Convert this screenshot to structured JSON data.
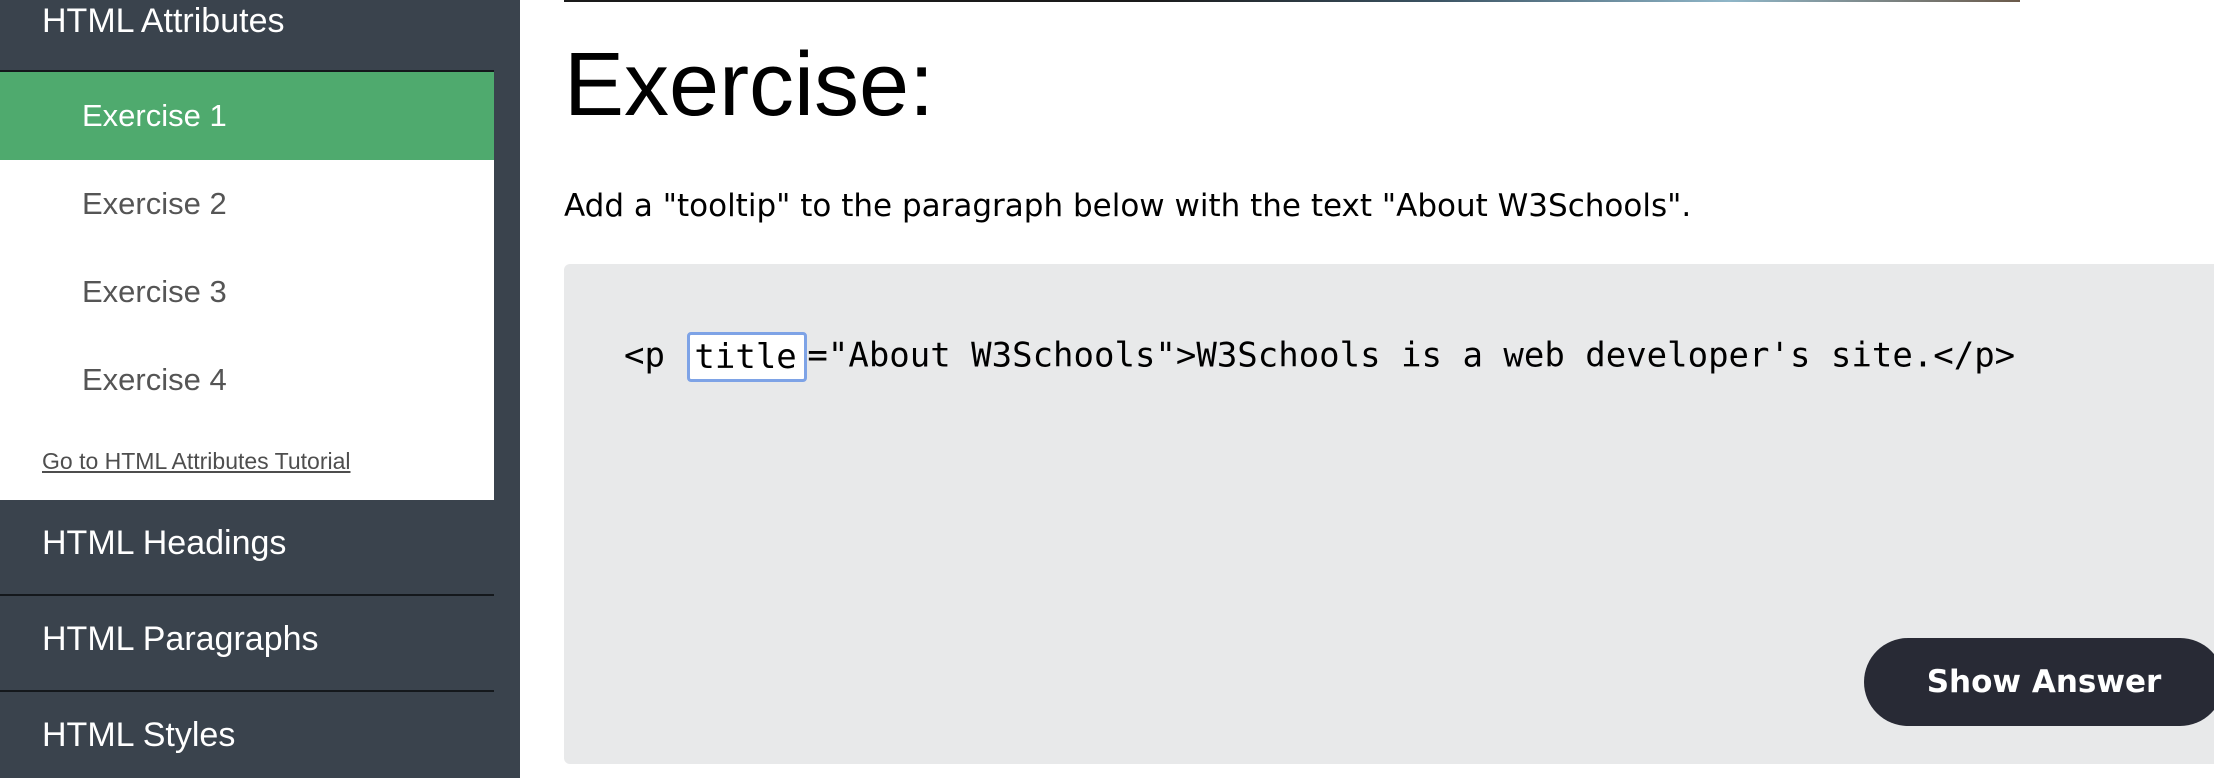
{
  "sidebar": {
    "section_title": "HTML Attributes",
    "exercises": [
      {
        "label": "Exercise 1",
        "active": true
      },
      {
        "label": "Exercise 2",
        "active": false
      },
      {
        "label": "Exercise 3",
        "active": false
      },
      {
        "label": "Exercise 4",
        "active": false
      }
    ],
    "tutorial_link": "Go to HTML Attributes Tutorial",
    "next_sections": [
      "HTML Headings",
      "HTML Paragraphs",
      "HTML Styles"
    ]
  },
  "main": {
    "title": "Exercise:",
    "instruction": "Add a \"tooltip\" to the paragraph below with the text \"About W3Schools\".",
    "code": {
      "prefix": "<p ",
      "input_value": "title",
      "suffix": "=\"About W3Schools\">W3Schools is a web developer's site.</p>"
    },
    "show_answer_label": "Show Answer"
  },
  "colors": {
    "sidebar_bg": "#3a434d",
    "active_item": "#4faa6e",
    "code_bg": "#e8e9ea",
    "button_bg": "#282a35",
    "input_border": "#7ea3e6"
  }
}
